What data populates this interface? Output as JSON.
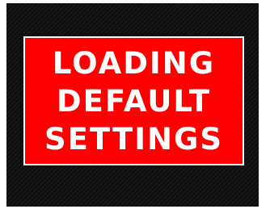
{
  "colors": {
    "background": "#111111",
    "panel": "#ff0000",
    "text": "#ffffff",
    "border": "#ffffff"
  },
  "message": {
    "lines": [
      "LOADING",
      "DEFAULT",
      "SETTINGS"
    ]
  }
}
